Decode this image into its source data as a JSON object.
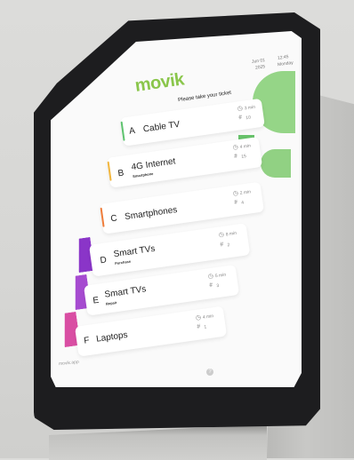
{
  "app": {
    "logo": "movik",
    "header_date": "Jun 01",
    "header_time": "12:45",
    "header_sub1": "2025",
    "header_sub2": "Monday",
    "prompt": "Please take your ticket"
  },
  "colors": {
    "brand_green": "#8ac64b",
    "accent_green": "#5ec36f",
    "accent_yellow": "#f2b63d",
    "accent_orange": "#ef7d3b",
    "accent_purple": "#8a35c8",
    "accent_pink": "#d94ea3"
  },
  "services": [
    {
      "letter": "A",
      "title": "Cable TV",
      "subtitle": "",
      "wait": "3 min",
      "queue": "10"
    },
    {
      "letter": "B",
      "title": "4G Internet",
      "subtitle": "Smartphone",
      "wait": "4 min",
      "queue": "15"
    },
    {
      "letter": "C",
      "title": "Smartphones",
      "subtitle": "",
      "wait": "2 min",
      "queue": "4"
    },
    {
      "letter": "D",
      "title": "Smart TVs",
      "subtitle": "Purchase",
      "wait": "8 min",
      "queue": "2"
    },
    {
      "letter": "E",
      "title": "Smart TVs",
      "subtitle": "Repair",
      "wait": "5 min",
      "queue": "3"
    },
    {
      "letter": "F",
      "title": "Laptops",
      "subtitle": "",
      "wait": "4 min",
      "queue": "1"
    }
  ],
  "footer": {
    "brand": "movik.app",
    "help_icon": "help-icon"
  }
}
